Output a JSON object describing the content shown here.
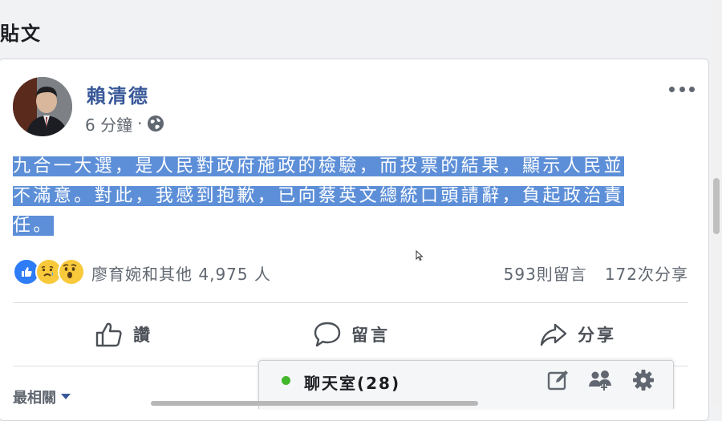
{
  "section_title": "貼文",
  "post": {
    "author": "賴清德",
    "timestamp": "6 分鐘",
    "separator": "·",
    "privacy_icon": "globe-icon",
    "text_lines": [
      "九合一大選，是人民對政府施政的檢驗，而投票的結果，顯示人民並",
      "不滿意。對此，我感到抱歉，已向蔡英文總統口頭請辭，負起政治責",
      "任。"
    ],
    "reactions": {
      "icons": [
        "like-icon",
        "sad-icon",
        "wow-icon"
      ],
      "summary": "廖育婉和其他 4,975 人"
    },
    "comments": "593則留言",
    "shares": "172次分享"
  },
  "actions": {
    "like": "讚",
    "comment": "留言",
    "share": "分享"
  },
  "sort_label": "最相關",
  "chat": {
    "label": "聊天室(28)",
    "status_color": "#42b72a"
  },
  "colors": {
    "author_link": "#385898",
    "selection_highlight": "#5d8fd8",
    "like_blue": "#2e7cf6"
  }
}
